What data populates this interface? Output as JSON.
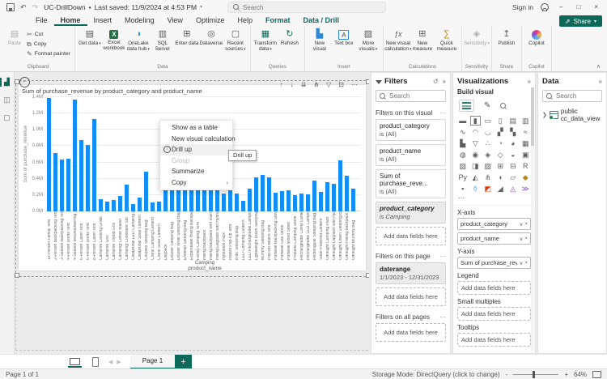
{
  "titlebar": {
    "title": "UC-DrillDown",
    "dot": "•",
    "last_saved": "Last saved: 11/9/2024 at 4:53 PM",
    "search_placeholder": "Search",
    "sign_in": "Sign in"
  },
  "menubar": {
    "items": [
      "File",
      "Home",
      "Insert",
      "Modeling",
      "View",
      "Optimize",
      "Help",
      "Format",
      "Data / Drill"
    ],
    "active_index": 1,
    "contextual": [
      "Format",
      "Data / Drill"
    ],
    "share_label": "Share"
  },
  "ribbon": {
    "groups": [
      {
        "name": "Clipboard",
        "layout": "clipboard",
        "big": {
          "label": "Paste",
          "icon": "paste",
          "disabled": true
        },
        "small": [
          {
            "label": "Cut",
            "icon": "scissors"
          },
          {
            "label": "Copy",
            "icon": "copy"
          },
          {
            "label": "Format painter",
            "icon": "brush"
          }
        ]
      },
      {
        "name": "Data",
        "buttons": [
          {
            "label": "Get data",
            "icon": "database",
            "caret": true
          },
          {
            "label": "Excel workbook",
            "icon": "excel"
          },
          {
            "label": "OneLake data hub",
            "icon": "onelake",
            "caret": true
          },
          {
            "label": "SQL Server",
            "icon": "sql"
          },
          {
            "label": "Enter data",
            "icon": "grid-plus"
          },
          {
            "label": "Dataverse",
            "icon": "dataverse"
          },
          {
            "label": "Recent sources",
            "icon": "recent",
            "caret": true
          }
        ]
      },
      {
        "name": "Queries",
        "buttons": [
          {
            "label": "Transform data",
            "icon": "transform",
            "caret": true
          },
          {
            "label": "Refresh",
            "icon": "refresh"
          }
        ]
      },
      {
        "name": "Insert",
        "buttons": [
          {
            "label": "New visual",
            "icon": "new-visual"
          },
          {
            "label": "Text box",
            "icon": "text-box"
          },
          {
            "label": "More visuals",
            "icon": "more-visuals",
            "caret": true
          }
        ]
      },
      {
        "name": "Calculations",
        "buttons": [
          {
            "label": "New visual calculation",
            "icon": "fx",
            "caret": true
          },
          {
            "label": "New measure",
            "icon": "calculator"
          },
          {
            "label": "Quick measure",
            "icon": "quick"
          }
        ]
      },
      {
        "name": "Sensitivity",
        "buttons": [
          {
            "label": "Sensitivity",
            "icon": "sensitivity",
            "caret": true,
            "disabled": true
          }
        ]
      },
      {
        "name": "Share",
        "buttons": [
          {
            "label": "Publish",
            "icon": "publish"
          }
        ]
      },
      {
        "name": "Copilot",
        "buttons": [
          {
            "label": "Copilot",
            "icon": "copilot"
          }
        ]
      }
    ]
  },
  "canvas": {
    "visual_header_icons": [
      {
        "name": "drill-up",
        "glyph": "↑"
      },
      {
        "name": "drill-down",
        "glyph": "↓"
      },
      {
        "name": "go-to-next-level",
        "glyph": "⇊"
      },
      {
        "name": "expand-all-levels",
        "glyph": "⋔"
      },
      {
        "name": "filter",
        "glyph": "▽"
      },
      {
        "name": "focus-mode",
        "glyph": "⊡"
      },
      {
        "name": "more-options",
        "glyph": "⋯"
      }
    ],
    "context_menu": {
      "items": [
        {
          "label": "Show as a table"
        },
        {
          "label": "New visual calculation"
        },
        {
          "label": "Drill up",
          "icon": "drill-up",
          "highlighted": true
        },
        {
          "label": "Group",
          "disabled": true
        },
        {
          "label": "Summarize"
        },
        {
          "label": "Copy",
          "submenu": true
        }
      ],
      "tooltip": "Drill up"
    }
  },
  "chart_data": {
    "type": "bar",
    "title": "Sum of purchase_revenue by product_category and product_name",
    "ylabel": "Sum of purchase_revenue",
    "xlabel": "product_name",
    "category_label": "Camping",
    "ylim": [
      0,
      1.4
    ],
    "unit": "M",
    "yticks": [
      "1.4M",
      "1.2M",
      "1.0M",
      "0.8M",
      "0.6M",
      "0.4M",
      "0.2M",
      "0.0M"
    ],
    "bar_color": "#118DFF",
    "categories": [
      "10-Person Family Tent",
      "2-Person Backpacking Tent",
      "3-Season Backpacking Tent",
      "4-Person Dome Tent",
      "4-Season Mountaineering T...",
      "6-Person Cabin Tent",
      "6-Person Dome Tent",
      "8-Person Cabin Tent",
      "Campfire Cooking Grate",
      "Campfire Grill",
      "Campfire Tripod Grill",
      "Camping Coffee Maker",
      "Camping Cookware Set",
      "Collapsible LED Camping La...",
      "Collapsible Solar Lantern",
      "Couples Sleeping Bag",
      "Crank Camping Lantern",
      "Crank Solar Lantern",
      "Daypack",
      "Double Sleeping Bag",
      "Double Wide Sleeping Bag",
      "Envelop Sleeping Bag",
      "Expandable Hiking Backpack",
      "Family Camping Tent",
      "Hiking Backpack",
      "Hiking Backpack with Rain C...",
      "Hiking Daypack with Hydrat...",
      "Hydration Pack",
      "Instant Pop-Up Tent",
      "Kids' Sleeping Bag",
      "LED Camping Lantern",
      "LED Rechargeable Campin...",
      "Lightweight Down Sleeping...",
      "Mummy Sleeping Bag",
      "Pop-Up Beach Tent",
      "Portable Backpacking Stove",
      "Portable Gas Stove",
      "Portable Wood Stove",
      "Propane Camping Stove",
      "Rechargeable Camp Lantern",
      "Rechargeable LED Camping...",
      "Rectangular Sleeping Bag",
      "Solar-Powered Lantern",
      "Ultralight Camping Pack",
      "Ultralight Daypack with Hyd...",
      "Ultralight Down Sleeping Bag",
      "Ultralight Hiking Backpack",
      "Ultralight Mummy Bag"
    ],
    "values": [
      1.39,
      0.71,
      0.64,
      0.65,
      1.37,
      0.87,
      0.81,
      1.13,
      0.15,
      0.12,
      0.14,
      0.19,
      0.33,
      0.09,
      0.17,
      0.49,
      0.11,
      0.12,
      0.27,
      0.35,
      0.35,
      0.35,
      0.35,
      0.35,
      0.35,
      0.35,
      0.35,
      0.22,
      0.62,
      0.22,
      0.13,
      0.28,
      0.42,
      0.45,
      0.42,
      0.23,
      0.25,
      0.26,
      0.2,
      0.22,
      0.21,
      0.38,
      0.24,
      0.36,
      0.34,
      0.63,
      0.44,
      0.28
    ]
  },
  "filters_pane": {
    "title": "Filters",
    "search_placeholder": "Search",
    "sections": [
      {
        "header": "Filters on this visual",
        "cards": [
          {
            "field": "product_category",
            "condition": "is (All)"
          },
          {
            "field": "product_name",
            "condition": "is (All)"
          },
          {
            "field": "Sum of purchase_reve...",
            "condition": "is (All)"
          },
          {
            "field": "product_category",
            "condition": "is Camping",
            "applied": true,
            "italic": true
          }
        ],
        "placeholder": "Add data fields here"
      },
      {
        "header": "Filters on this page",
        "cards": [
          {
            "field": "daterange",
            "condition": "1/1/2023 - 12/31/2023",
            "applied": true
          }
        ],
        "placeholder": "Add data fields here"
      },
      {
        "header": "Filters on all pages",
        "cards": [],
        "placeholder": "Add data fields here"
      }
    ]
  },
  "viz_pane": {
    "title": "Visualizations",
    "subtitle": "Build visual",
    "icons": [
      {
        "name": "stacked-bar-chart",
        "glyph": "▬"
      },
      {
        "name": "stacked-column-chart",
        "glyph": "▮",
        "selected": true
      },
      {
        "name": "clustered-bar-chart",
        "glyph": "▭"
      },
      {
        "name": "clustered-column-chart",
        "glyph": "▯"
      },
      {
        "name": "100-stacked-bar-chart",
        "glyph": "▤"
      },
      {
        "name": "100-stacked-column-chart",
        "glyph": "▥"
      },
      {
        "name": "line-chart",
        "glyph": "∿"
      },
      {
        "name": "area-chart",
        "glyph": "◠"
      },
      {
        "name": "stacked-area-chart",
        "glyph": "◡"
      },
      {
        "name": "line-and-stacked-column-chart",
        "glyph": "▞"
      },
      {
        "name": "line-and-clustered-column-chart",
        "glyph": "▚"
      },
      {
        "name": "ribbon-chart",
        "glyph": "≈"
      },
      {
        "name": "waterfall-chart",
        "glyph": "▙"
      },
      {
        "name": "funnel-chart",
        "glyph": "▽"
      },
      {
        "name": "scatter-chart",
        "glyph": "∴"
      },
      {
        "name": "pie-chart",
        "glyph": "◔"
      },
      {
        "name": "donut-chart",
        "glyph": "◕"
      },
      {
        "name": "treemap",
        "glyph": "▦"
      },
      {
        "name": "map",
        "glyph": "◍"
      },
      {
        "name": "filled-map",
        "glyph": "◉"
      },
      {
        "name": "shape-map",
        "glyph": "◈"
      },
      {
        "name": "azure-map",
        "glyph": "◇"
      },
      {
        "name": "gauge",
        "glyph": "◒"
      },
      {
        "name": "card",
        "glyph": "▣"
      },
      {
        "name": "multi-row-card",
        "glyph": "▧"
      },
      {
        "name": "kpi",
        "glyph": "◨"
      },
      {
        "name": "slicer",
        "glyph": "▨"
      },
      {
        "name": "table",
        "glyph": "⊞"
      },
      {
        "name": "matrix",
        "glyph": "⊟"
      },
      {
        "name": "r-script-visual",
        "glyph": "R"
      },
      {
        "name": "python-visual",
        "glyph": "Py"
      },
      {
        "name": "key-influencers",
        "glyph": "◭"
      },
      {
        "name": "decomposition-tree",
        "glyph": "⋔"
      },
      {
        "name": "qa-visual",
        "glyph": "◖"
      },
      {
        "name": "smart-narrative",
        "glyph": "▱"
      },
      {
        "name": "metrics",
        "glyph": "◆",
        "color": "#b5890f"
      },
      {
        "name": "paginated-report",
        "glyph": "▪"
      },
      {
        "name": "arcgis-map",
        "glyph": "◊",
        "color": "#2b88d8"
      },
      {
        "name": "power-automate",
        "glyph": "◩",
        "color": "#d83b01"
      },
      {
        "name": "button-slicer",
        "glyph": "◢"
      },
      {
        "name": "text-slicer",
        "glyph": "◬",
        "color": "#8250c4"
      },
      {
        "name": "get-more-visuals",
        "glyph": "≫",
        "color": "#8250c4"
      }
    ],
    "more_glyph": "⋯",
    "wells": [
      {
        "label": "X-axis",
        "pills": [
          {
            "value": "product_category"
          },
          {
            "value": "product_name"
          }
        ]
      },
      {
        "label": "Y-axis",
        "pills": [
          {
            "value": "Sum of purchase_reve..."
          }
        ]
      },
      {
        "label": "Legend",
        "placeholder": "Add data fields here"
      },
      {
        "label": "Small multiples",
        "placeholder": "Add data fields here"
      },
      {
        "label": "Tooltips",
        "placeholder": "Add data fields here"
      }
    ]
  },
  "data_pane": {
    "title": "Data",
    "search_placeholder": "Search",
    "items": [
      {
        "label": "public cc_data_view"
      }
    ]
  },
  "page_bar": {
    "page_tab": "Page 1"
  },
  "status_bar": {
    "left": "Page 1 of 1",
    "storage": "Storage Mode: DirectQuery (click to change)",
    "zoom": "64%"
  }
}
